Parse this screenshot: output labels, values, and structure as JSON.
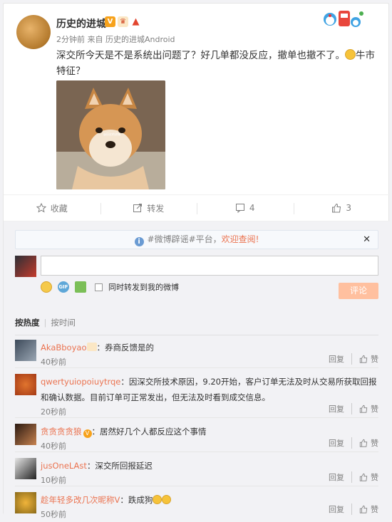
{
  "post": {
    "username": "历史的进城",
    "time": "2分钟前",
    "source": "来自 历史的进城Android",
    "text": "深交所今天是不是系统出问题了？好几单都没反应，撤单也撤不了。",
    "text_tail": "牛市特征？",
    "image_alt": "@历史的进城"
  },
  "actions": {
    "favorite": "收藏",
    "repost": "转发",
    "comment_count": "4",
    "like_count": "3"
  },
  "notice": {
    "prefix": "#微博辟谣#平台，",
    "link": "欢迎查阅!"
  },
  "composer": {
    "placeholder": "",
    "also_repost": "同时转发到我的微博",
    "submit": "评论"
  },
  "sort": {
    "hot": "按热度",
    "time": "按时间"
  },
  "comments": [
    {
      "name": "AkaBboyao",
      "text": "：券商反馈是的",
      "time": "40秒前",
      "reply": "回复",
      "like": "赞"
    },
    {
      "name": "qwertyuiopoiuytrqe",
      "text": "：因深交所技术原因，9.20开始，客户订单无法及时从交易所获取回报和确认数据。目前订单可正常发出，但无法及时看到成交信息。",
      "time": "20秒前",
      "reply": "回复",
      "like": "赞"
    },
    {
      "name": "贪贪贪贪狼",
      "text": "：居然好几个人都反应这个事情",
      "time": "40秒前",
      "reply": "回复",
      "like": "赞"
    },
    {
      "name": "jusOneLAst",
      "text": "：深交所回报延迟",
      "time": "10秒前",
      "reply": "回复",
      "like": "赞"
    },
    {
      "name": "趁年轻多改几次昵称V",
      "text": "：跌成狗",
      "time": "50秒前",
      "reply": "回复",
      "like": "赞"
    }
  ],
  "colors": {
    "accent": "#eb7350",
    "submit_bg": "#ffc09f",
    "link_blue": "#6a9bd3"
  }
}
